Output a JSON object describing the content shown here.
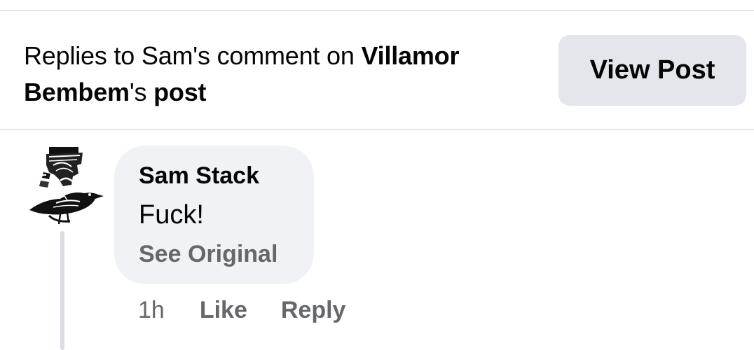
{
  "header": {
    "title_prefix": "Replies to Sam's comment on ",
    "post_owner": "Villamor Bembem",
    "title_suffix_possessive": "'s ",
    "title_suffix_post": "post",
    "view_post_label": "View Post"
  },
  "comment": {
    "author": "Sam Stack",
    "text": "Fuck!",
    "see_original_label": "See Original",
    "timestamp": "1h",
    "like_label": "Like",
    "reply_label": "Reply",
    "avatar_icon": "bird-avatar-icon"
  },
  "colors": {
    "background": "#ffffff",
    "divider": "#e4e6eb",
    "bubble": "#f0f2f5",
    "button": "#e4e6eb",
    "primary_text": "#050505",
    "secondary_text": "#65676b",
    "thread_line": "#dadde1"
  }
}
